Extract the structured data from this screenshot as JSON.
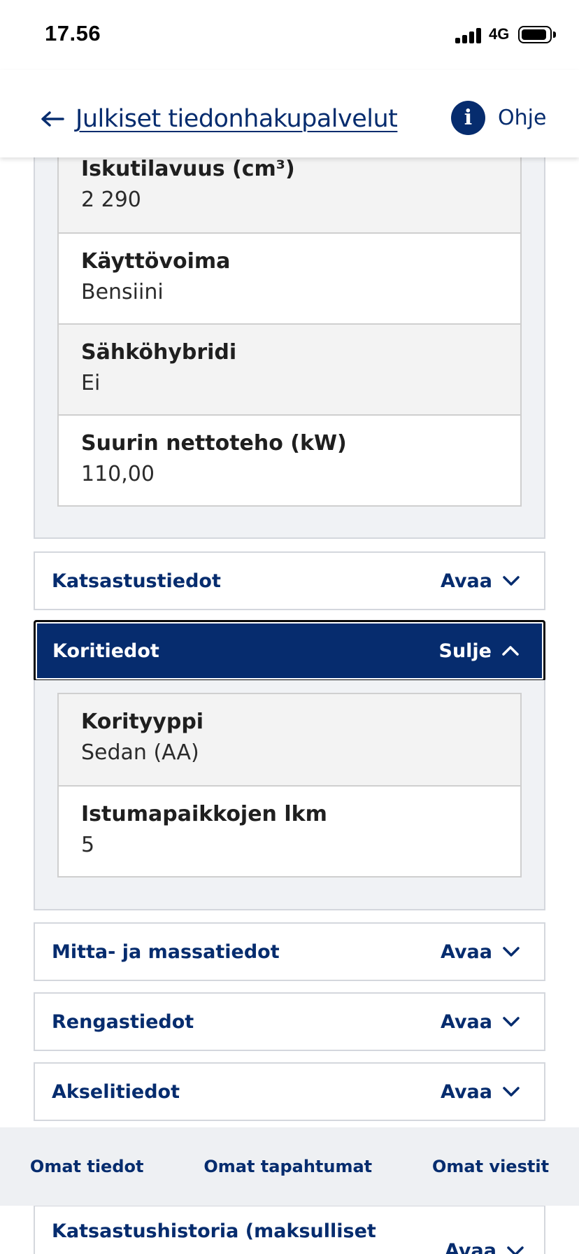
{
  "status_bar": {
    "time": "17.56",
    "network": "4G"
  },
  "header": {
    "back_label": "Julkiset tiedonhakupalvelut",
    "help_label": "Ohje"
  },
  "engine_fields": [
    {
      "label": "Iskutilavuus (cm³)",
      "value": "2 290"
    },
    {
      "label": "Käyttövoima",
      "value": "Bensiini"
    },
    {
      "label": "Sähköhybridi",
      "value": "Ei"
    },
    {
      "label": "Suurin nettoteho (kW)",
      "value": "110,00"
    }
  ],
  "sections": {
    "katsastustiedot": {
      "title": "Katsastustiedot",
      "action": "Avaa"
    },
    "koritiedot": {
      "title": "Koritiedot",
      "action": "Sulje"
    },
    "mitta": {
      "title": "Mitta- ja massatiedot",
      "action": "Avaa"
    },
    "rengas": {
      "title": "Rengastiedot",
      "action": "Avaa"
    },
    "akseli": {
      "title": "Akselitiedot",
      "action": "Avaa"
    },
    "historia": {
      "title": "Katsastushistoria (maksulliset",
      "action": "Avaa"
    }
  },
  "body_fields": [
    {
      "label": "Korityyppi",
      "value": "Sedan (AA)"
    },
    {
      "label": "Istumapaikkojen lkm",
      "value": "5"
    }
  ],
  "bottom_nav": [
    "Omat tiedot",
    "Omat tapahtumat",
    "Omat viestit"
  ],
  "colors": {
    "brand_blue": "#062c6e",
    "panel_bg": "#f0f2f5"
  }
}
